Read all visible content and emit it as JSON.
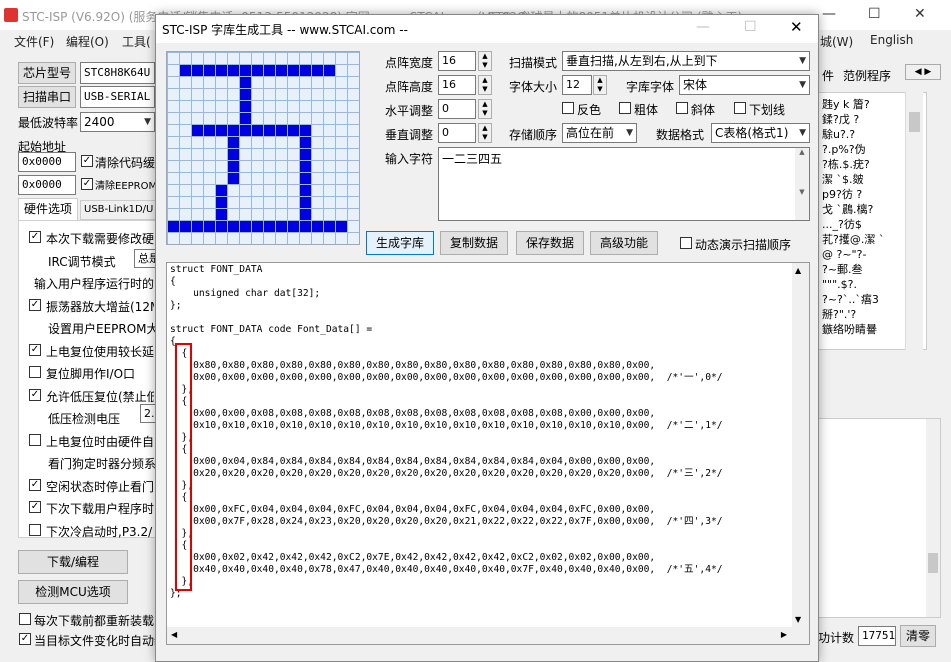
{
  "app": {
    "title": "STC-ISP (V6.92O) (服务电话/销售电话: 0513-55012928) 官网: www.STCAI.com  (V6.92O)",
    "title_tail": "STC: 全球最大的8051单片机设计公司 (雕心工)"
  },
  "menu": {
    "file": "文件(F)",
    "edit": "编程(O)",
    "tools": "工具(",
    "english": "English",
    "settings": "城(W)"
  },
  "left": {
    "chip_label": "芯片型号",
    "chip_value": "STC8H8K64U",
    "port_label": "扫描串口",
    "port_value": "USB-SERIAL C",
    "baud_label": "最低波特率",
    "baud_value": "2400",
    "start_addr": "起始地址",
    "addr1": "0x0000",
    "addr2": "0x0000",
    "clear_code": "清除代码缓",
    "clear_eeprom": "清除EEPROM",
    "tab_hw": "硬件选项",
    "tab_usb": "USB-Link1D/U",
    "opts": [
      "本次下载需要修改硬",
      "IRC调节模式",
      "输入用户程序运行时的",
      "振荡器放大增益(12M",
      "设置用户EEPROM大小",
      "上电复位使用较长延",
      "复位脚用作I/O口",
      "允许低压复位(禁止低",
      "低压检测电压",
      "上电复位时由硬件自",
      "看门狗定时器分频系",
      "空闲状态时停止看门",
      "下次下载用户程序时",
      "下次冷启动时,P3.2/"
    ],
    "irc_value": "总是动",
    "lv_value": "2.",
    "download": "下载/编程",
    "detect": "检测MCU选项",
    "bottom1": "每次下载前都重新装载目",
    "bottom2": "当目标文件变化时自动装载并发送下载命令"
  },
  "right": {
    "tab_plug": "件",
    "tab_prog": "范例程序",
    "garble": [
      "韪y k 篃?",
      "鍒?戊 ?",
      "駼u?.?",
      "?.p%?伪",
      "?栋.$.疣?",
      "潔 `$.皴",
      "p9?彷 ?",
      "戈 `鷐.樆?",
      "..._?彷$",
      "芤?擭@.潔 `",
      "@ ?~\"?-",
      "?~郵.叁",
      "\"\"\".$?.",
      "?~?`..`痦3",
      "掰?\".'?",
      "鏃络吩睛謈"
    ],
    "count_label": "功计数",
    "count_value": "17751",
    "clear": "清零"
  },
  "dialog": {
    "title": "STC-ISP 字库生成工具 -- www.STCAI.com --",
    "width_label": "点阵宽度",
    "width_value": "16",
    "height_label": "点阵高度",
    "height_value": "16",
    "hadj_label": "水平调整",
    "hadj_value": "0",
    "vadj_label": "垂直调整",
    "vadj_value": "0",
    "scan_label": "扫描模式",
    "scan_value": "垂直扫描,从左到右,从上到下",
    "size_label": "字体大小",
    "size_value": "12",
    "font_label": "字库字体",
    "font_value": "宋体",
    "inv": "反色",
    "bold": "粗体",
    "italic": "斜体",
    "underline": "下划线",
    "order_label": "存储顺序",
    "order_value": "高位在前",
    "fmt_label": "数据格式",
    "fmt_value": "C表格(格式1)",
    "input_label": "输入字符",
    "input_value": "一二三四五",
    "gen": "生成字库",
    "copy": "复制数据",
    "save": "保存数据",
    "adv": "高级功能",
    "demo": "动态演示扫描顺序",
    "code_lines": [
      "struct FONT_DATA",
      "{",
      "    unsigned char dat[32];",
      "};",
      "",
      "struct FONT_DATA code Font_Data[] =",
      "{",
      "  {",
      "    0x80,0x80,0x80,0x80,0x80,0x80,0x80,0x80,0x80,0x80,0x80,0x80,0x80,0x80,0x80,0x00,",
      "    0x00,0x00,0x00,0x00,0x00,0x00,0x00,0x00,0x00,0x00,0x00,0x00,0x00,0x00,0x00,0x00,  /*'一',0*/",
      "  },",
      "  {",
      "    0x00,0x00,0x08,0x08,0x08,0x08,0x08,0x08,0x08,0x08,0x08,0x08,0x08,0x00,0x00,0x00,",
      "    0x10,0x10,0x10,0x10,0x10,0x10,0x10,0x10,0x10,0x10,0x10,0x10,0x10,0x10,0x10,0x00,  /*'二',1*/",
      "  },",
      "  {",
      "    0x00,0x04,0x84,0x84,0x84,0x84,0x84,0x84,0x84,0x84,0x84,0x84,0x04,0x00,0x00,0x00,",
      "    0x20,0x20,0x20,0x20,0x20,0x20,0x20,0x20,0x20,0x20,0x20,0x20,0x20,0x20,0x20,0x00,  /*'三',2*/",
      "  },",
      "  {",
      "    0x00,0xFC,0x04,0x04,0x04,0xFC,0x04,0x04,0x04,0xFC,0x04,0x04,0x04,0xFC,0x00,0x00,",
      "    0x00,0x7F,0x28,0x24,0x23,0x20,0x20,0x20,0x20,0x21,0x22,0x22,0x22,0x7F,0x00,0x00,  /*'四',3*/",
      "  },",
      "  {",
      "    0x00,0x02,0x42,0x42,0x42,0xC2,0x7E,0x42,0x42,0x42,0x42,0xC2,0x02,0x02,0x00,0x00,",
      "    0x40,0x40,0x40,0x40,0x78,0x47,0x40,0x40,0x40,0x40,0x40,0x7F,0x40,0x40,0x40,0x00,  /*'五',4*/",
      "  },",
      "};"
    ]
  },
  "colors": {
    "pixel_on": "#0000e0",
    "highlight": "#e00000",
    "grid_bg": "#e8f0fa",
    "grid_line": "#9bb8d8"
  }
}
